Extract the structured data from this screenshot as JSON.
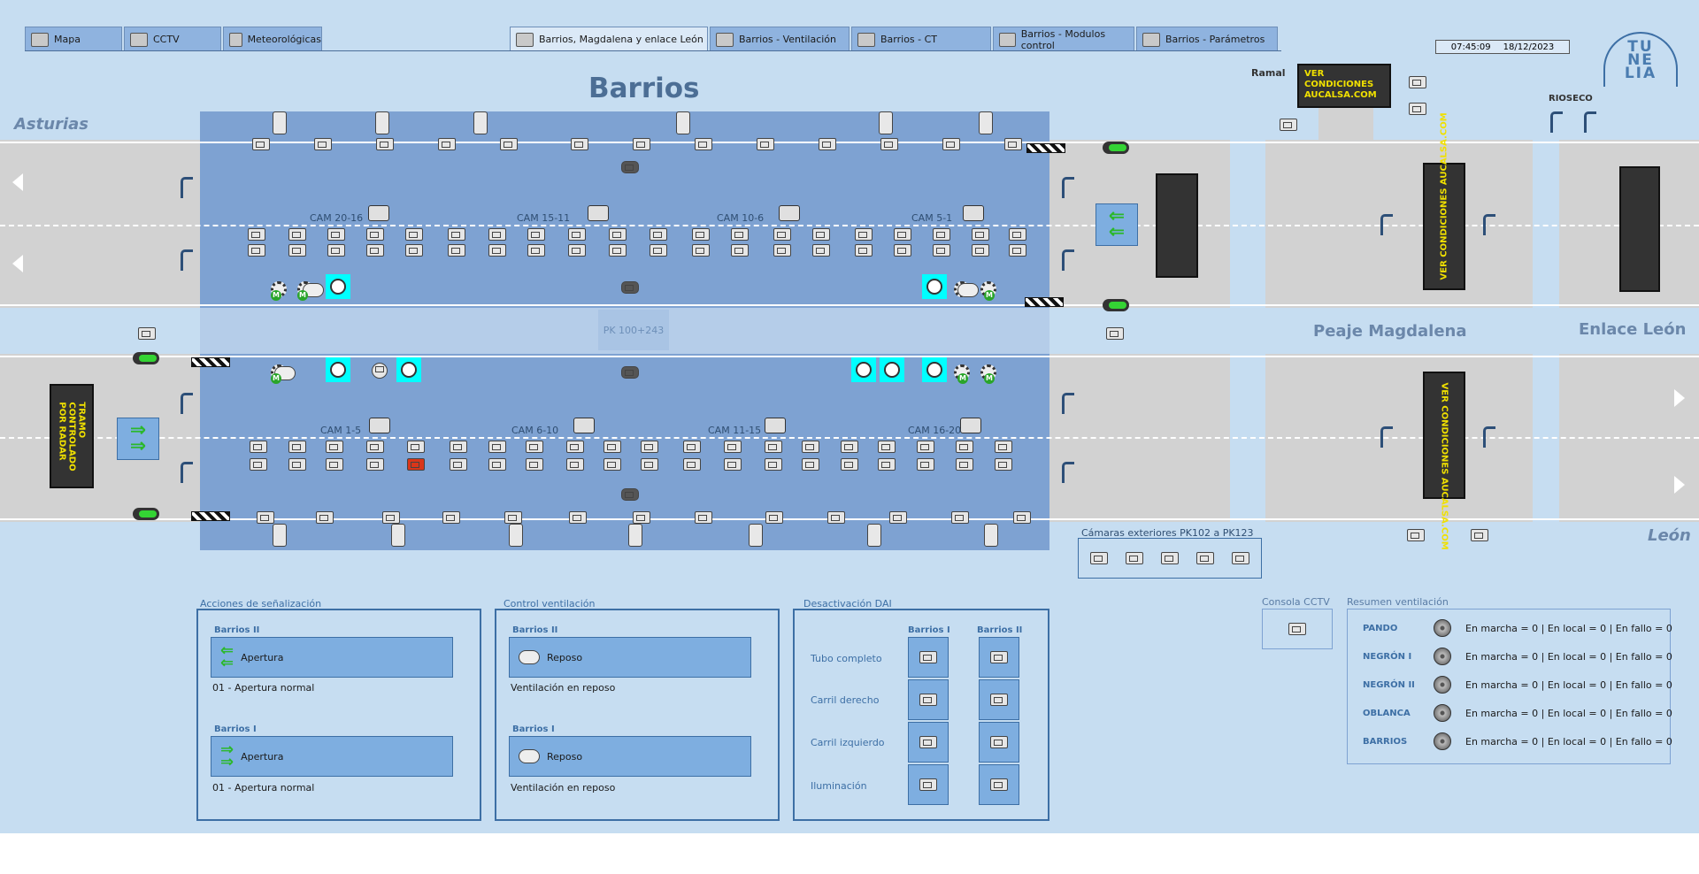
{
  "tabs": [
    {
      "label": "Mapa",
      "icon": "map-icon"
    },
    {
      "label": "CCTV",
      "icon": "cctv-icon"
    },
    {
      "label": "Meteorológicas",
      "icon": "weather-icon"
    },
    {
      "label": "Barrios, Magdalena y enlace León",
      "icon": "screen-icon"
    },
    {
      "label": "Barrios - Ventilación",
      "icon": "fan-icon"
    },
    {
      "label": "Barrios - CT",
      "icon": "ct-icon"
    },
    {
      "label": "Barrios - Modulos control",
      "icon": "control-module-icon"
    },
    {
      "label": "Barrios - Parámetros",
      "icon": "gear-icon"
    }
  ],
  "clock": {
    "time": "07:45:09",
    "date": "18/12/2023"
  },
  "logo": {
    "text": "TUNELIA"
  },
  "map": {
    "title": "Barrios",
    "asturias": "Asturias",
    "leon": "León",
    "ramal": "Ramal",
    "rioseco": "RIOSECO",
    "peaje": "Peaje Magdalena",
    "enlace": "Enlace León",
    "pk": "PK 100+243",
    "vms_ramal": "VER CONDICIONES AUCALSA.COM",
    "vms_right_top": "VER CONDICIONES AUCALSA.COM",
    "vms_right_bottom": "VER CONDICIONES AUCALSA.COM",
    "vms_left": "TRAMO CONTROLADO POR RADAR",
    "cams_top": [
      "CAM 20-16",
      "CAM 15-11",
      "CAM 10-6",
      "CAM 5-1"
    ],
    "cams_bottom": [
      "CAM 1-5",
      "CAM 6-10",
      "CAM 11-15",
      "CAM 16-20"
    ],
    "ext_cameras_label": "Cámaras exteriores PK102 a PK123"
  },
  "senalizacion": {
    "title": "Acciones de señalización",
    "b2": {
      "tube": "Barrios II",
      "button": "Apertura",
      "status": "01 - Apertura normal"
    },
    "b1": {
      "tube": "Barrios I",
      "button": "Apertura",
      "status": "01 - Apertura normal"
    }
  },
  "ventilacion": {
    "title": "Control ventilación",
    "b2": {
      "tube": "Barrios II",
      "button": "Reposo",
      "status": "Ventilación en reposo"
    },
    "b1": {
      "tube": "Barrios I",
      "button": "Reposo",
      "status": "Ventilación en reposo"
    }
  },
  "dai": {
    "title": "Desactivación DAI",
    "col1": "Barrios I",
    "col2": "Barrios II",
    "rows": [
      "Tubo completo",
      "Carril derecho",
      "Carril izquierdo",
      "Iluminación"
    ]
  },
  "consola": {
    "title": "Consola CCTV"
  },
  "resumen": {
    "title": "Resumen ventilación",
    "rows": [
      {
        "name": "PANDO",
        "text": "En marcha = 0 | En local = 0 | En fallo = 0"
      },
      {
        "name": "NEGRÓN I",
        "text": "En marcha = 0 | En local = 0 | En fallo = 0"
      },
      {
        "name": "NEGRÓN II",
        "text": "En marcha = 0 | En local = 0 | En fallo = 0"
      },
      {
        "name": "OBLANCA",
        "text": "En marcha = 0 | En local = 0 | En fallo = 0"
      },
      {
        "name": "BARRIOS",
        "text": "En marcha = 0 | En local = 0 | En fallo = 0"
      }
    ]
  },
  "colors": {
    "background": "#c6ddf1",
    "tube": "#7ea2d2",
    "road": "#d2d2d2",
    "accent": "#3d6fa5",
    "vms_text": "#f0e000",
    "active_device": "#00ffff"
  }
}
